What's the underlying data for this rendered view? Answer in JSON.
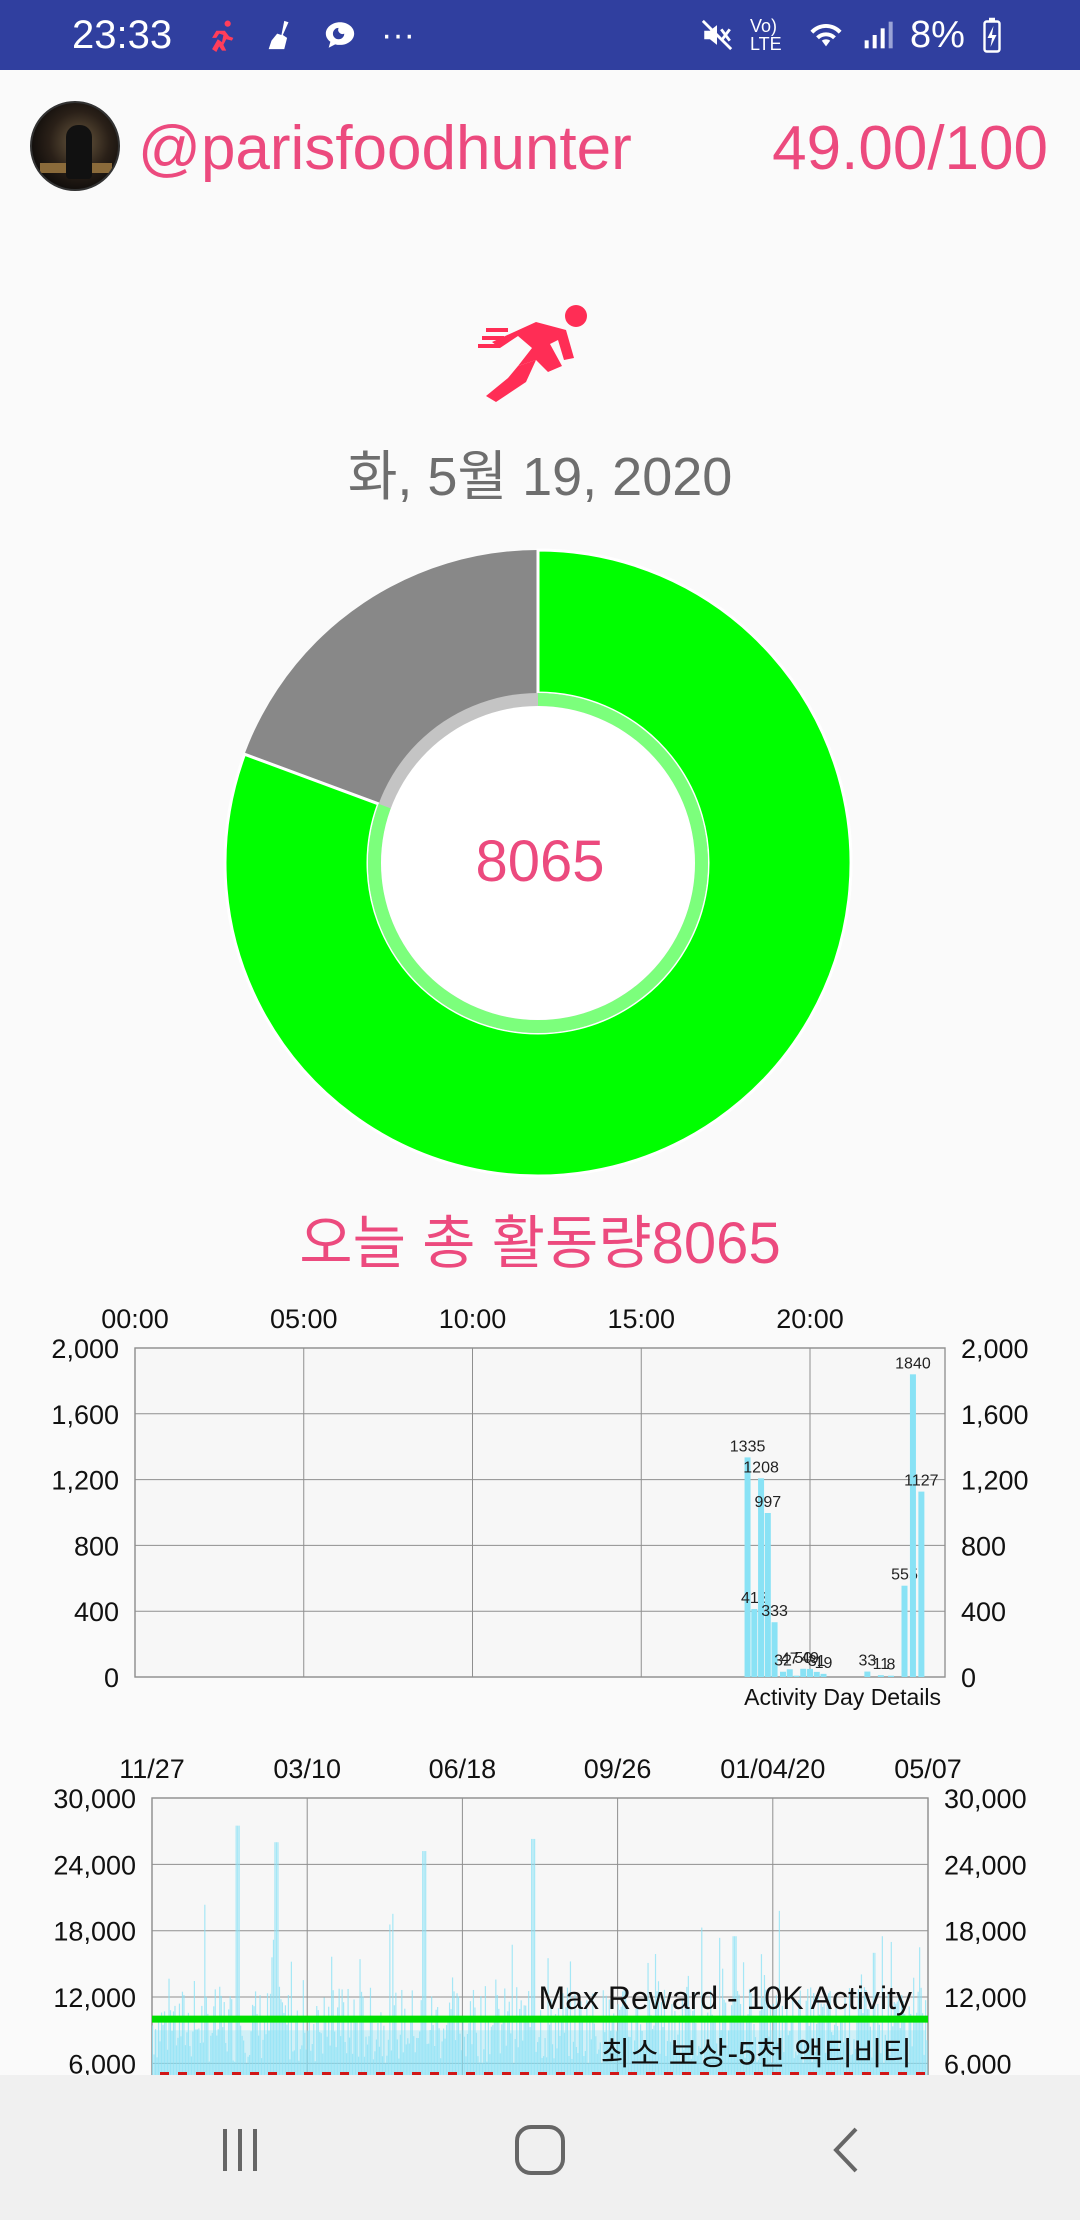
{
  "status_bar": {
    "time": "23:33",
    "battery": "8%",
    "network_label": "Vo) LTE",
    "left_icons": [
      "runner-icon",
      "broom-icon",
      "chat-bubble-icon",
      "more-dots-icon"
    ],
    "right_icons": [
      "mute-icon",
      "volte-icon",
      "wifi-icon",
      "signal-icon",
      "battery-charging-icon"
    ]
  },
  "header": {
    "username": "@parisfoodhunter",
    "score": "49.00/100"
  },
  "summary": {
    "date": "화, 5월 19, 2020",
    "donut_value": "8065",
    "today_total": "오늘 총 활동량8065"
  },
  "colors": {
    "accent": "#ec4a7e",
    "donut_progress": "#00ff00",
    "donut_remaining": "#888888",
    "bar_color": "#89e2f5",
    "status_bar": "#303f9f",
    "max_reward_line": "#00dd00",
    "min_reward_line": "#d11818"
  },
  "chart_data": [
    {
      "type": "bar",
      "title": "Activity Day Details",
      "x_tick_labels": [
        "00:00",
        "05:00",
        "10:00",
        "15:00",
        "20:00"
      ],
      "xlim": [
        0,
        24
      ],
      "ylim": [
        0,
        2000
      ],
      "y_tick_labels": [
        "2,000",
        "1,600",
        "1,200",
        "800",
        "400",
        "0"
      ],
      "y_ticks": [
        2000,
        1600,
        1200,
        800,
        400,
        0
      ],
      "bars": [
        {
          "x": 18.15,
          "value": 1335,
          "label": "1335"
        },
        {
          "x": 18.35,
          "value": 413,
          "label": "413"
        },
        {
          "x": 18.55,
          "value": 1208,
          "label": "1208"
        },
        {
          "x": 18.75,
          "value": 997,
          "label": "997"
        },
        {
          "x": 18.95,
          "value": 333,
          "label": "333"
        },
        {
          "x": 19.2,
          "value": 32,
          "label": "32"
        },
        {
          "x": 19.4,
          "value": 47,
          "label": "47"
        },
        {
          "x": 19.6,
          "value": 8,
          "label": ""
        },
        {
          "x": 19.8,
          "value": 50,
          "label": "50"
        },
        {
          "x": 20.0,
          "value": 49,
          "label": "49"
        },
        {
          "x": 20.2,
          "value": 31,
          "label": "31"
        },
        {
          "x": 20.4,
          "value": 19,
          "label": "19"
        },
        {
          "x": 21.7,
          "value": 33,
          "label": "33"
        },
        {
          "x": 22.1,
          "value": 11,
          "label": "11"
        },
        {
          "x": 22.4,
          "value": 8,
          "label": "8"
        },
        {
          "x": 22.8,
          "value": 555,
          "label": "555"
        },
        {
          "x": 23.05,
          "value": 1840,
          "label": "1840"
        },
        {
          "x": 23.3,
          "value": 1127,
          "label": "1127"
        }
      ]
    },
    {
      "type": "bar",
      "title": "",
      "x_tick_labels": [
        "11/27",
        "03/10",
        "06/18",
        "09/26",
        "01/04/20",
        "05/07"
      ],
      "ylim": [
        4500,
        30000
      ],
      "y_tick_labels": [
        "30,000",
        "24,000",
        "18,000",
        "12,000",
        "6,000"
      ],
      "y_ticks": [
        30000,
        24000,
        18000,
        12000,
        6000
      ],
      "reference_lines": [
        {
          "value": 10000,
          "label": "Max Reward - 10K Activity",
          "style": "solid"
        },
        {
          "value": 5000,
          "label": "최소 보상-5천 액티비티",
          "style": "dashed"
        }
      ],
      "series_note": "daily activity totals, mostly between 6,000 and 16,000 with peaks near 27,000",
      "peaks": [
        {
          "x": 0.11,
          "value": 27500
        },
        {
          "x": 0.16,
          "value": 26000
        },
        {
          "x": 0.35,
          "value": 25200
        },
        {
          "x": 0.49,
          "value": 26300
        },
        {
          "x": 0.75,
          "value": 17500
        },
        {
          "x": 0.93,
          "value": 16000
        }
      ]
    }
  ],
  "nav": {
    "recent_icon": "recent-apps-icon",
    "home_icon": "home-icon",
    "back_icon": "back-icon"
  }
}
